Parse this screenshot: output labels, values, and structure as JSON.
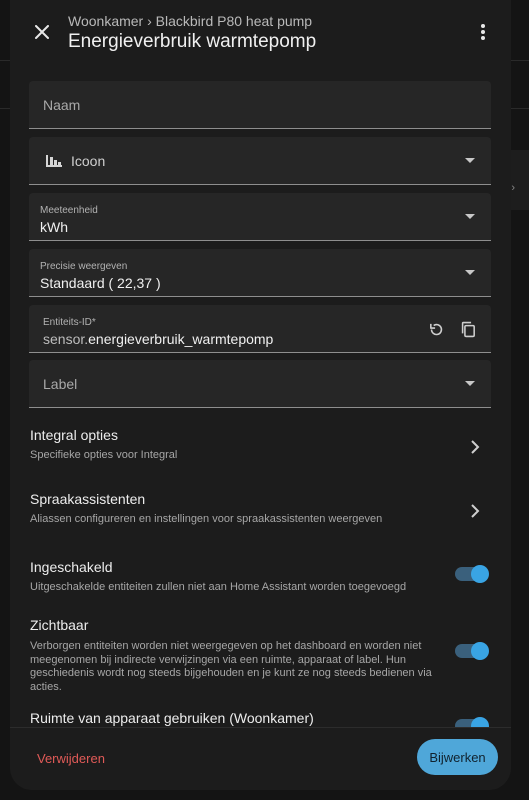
{
  "header": {
    "breadcrumb": "Woonkamer › Blackbird P80 heat pump",
    "title": "Energieverbruik warmtepomp",
    "close_icon": "close-icon",
    "more_icon": "more-vertical-icon"
  },
  "fields": {
    "name": {
      "placeholder": "Naam"
    },
    "icon": {
      "label": "Icoon",
      "icon": "meter-icon"
    },
    "unit": {
      "label": "Meeteenheid",
      "value": "kWh"
    },
    "precision": {
      "label": "Precisie weergeven",
      "value": "Standaard ( 22,37 )"
    },
    "entity_id": {
      "label": "Entiteits-ID*",
      "prefix": "sensor.",
      "value": "energieverbruik_warmtepomp"
    },
    "label": {
      "placeholder": "Label"
    }
  },
  "rows": {
    "integral": {
      "title": "Integral opties",
      "subtitle": "Specifieke opties voor Integral"
    },
    "voice": {
      "title": "Spraakassistenten",
      "subtitle": "Aliassen configureren en instellingen voor spraakassistenten weergeven"
    },
    "enabled": {
      "title": "Ingeschakeld",
      "subtitle": "Uitgeschakelde entiteiten zullen niet aan Home Assistant worden toegevoegd",
      "on": true
    },
    "visible": {
      "title": "Zichtbaar",
      "subtitle": "Verborgen entiteiten worden niet weergegeven op het dashboard en worden niet meegenomen bij indirecte verwijzingen via een ruimte, apparaat of label. Hun geschiedenis wordt nog steeds bijgehouden en je kunt ze nog steeds bedienen via acties.",
      "on": true
    },
    "device_area": {
      "title": "Ruimte van apparaat gebruiken (Woonkamer)",
      "on": true
    }
  },
  "footer": {
    "delete_label": "Verwijderen",
    "update_label": "Bijwerken"
  },
  "colors": {
    "accent": "#4fa7d9",
    "danger": "#e05a57",
    "toggle_on": "#39a4e4",
    "surface": "#1c1c1c",
    "field": "#262626"
  }
}
